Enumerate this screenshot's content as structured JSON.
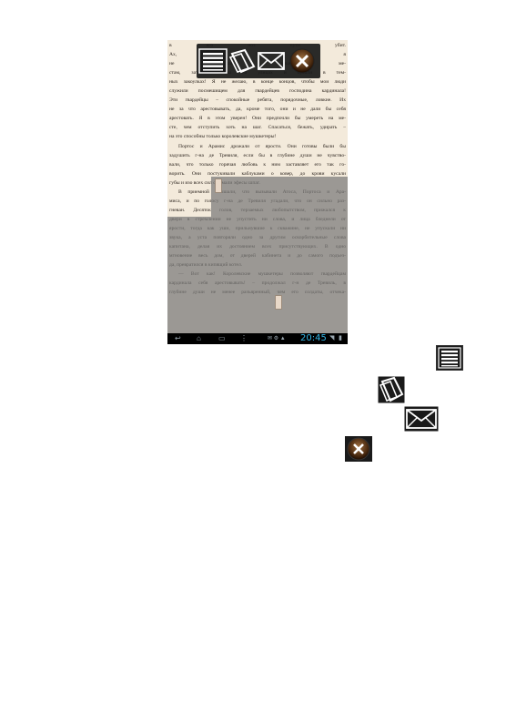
{
  "reader": {
    "lines": [
      "в его ноэ                                              пути убит.",
      "Ах, если б                                            которы, я",
      "не желаю                                               ьным ме-",
      "стам, затевая ссоры на улицах и кусали в тем-",
      "ных закоулках! Я не желаю, в конце концов, чтобы мои люди",
      "служили посмешищем для гвардейцев господина кардинала!",
      "Эти гвардейцы – спокойные ребята, порядочные, ловкие. Их",
      "не за что арестовывать, да, кроме того, они и не дали бы себя",
      "арестовать. Я в этом уверен! Они предпочли бы умереть на ме-",
      "сте, чем отступить хоть на шаг. Спасаться, бежать, удирать –",
      "на это способны только королевские мушкетеры!",
      "Портос и Арамис дрожали от ярости. Они готовы были бы",
      "задушить г-на де Тревиля, если бы в глубине души не чувство-",
      "вали, что только горячая любовь к ним заставляет его так го-",
      "ворить. Они постукивали каблуками о ковер, до крови кусали",
      "губы и изо всех сил сжимали эфесы шпаг.",
      "В приемной слышали, что вызывали Атоса, Портоса и Ара-",
      "миса, и по голосу г-на де Тревиля угадали, что он сильно раз-",
      "гневан. Десяток голов, терзаемых любопытством, прижался к",
      "двери в стремлении не упустить ни слова, и лица бледнели от",
      "ярости, тогда как уши, прильнувшие к скважине, не упускали ни",
      "звука, а уста повторяли одно за другим оскорбительные слова",
      "капитана, делая их достоянием всех присутствующих. В одно",
      "мгновение весь дом, от дверей кабинета и до самого подъез-",
      "да, превратился в кипящий котел.",
      "— Вот как! Королевские мушкетеры позволяют гвардейцам",
      "кардинала себя арестовывать! – продолжал г-н де Тревиль, в",
      "глубине души не менее разъяренный, чем его солдаты, отчека-"
    ],
    "clock": "20:45"
  },
  "icons": {
    "menu": "menu-icon",
    "rotate": "rotate-page-icon",
    "mail": "mail-icon",
    "close": "close-icon"
  },
  "colors": {
    "page": "#f3eadb",
    "selection": "#787878",
    "clock": "#33b5e5"
  }
}
